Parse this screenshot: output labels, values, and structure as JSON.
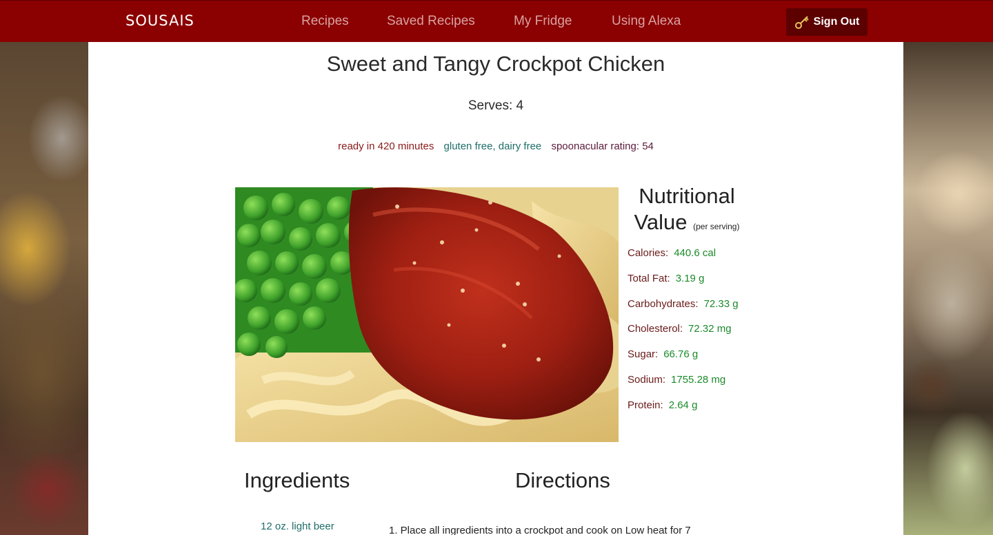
{
  "navbar": {
    "brand": "SOUSAIS",
    "links": [
      {
        "label": "Recipes"
      },
      {
        "label": "Saved Recipes"
      },
      {
        "label": "My Fridge"
      },
      {
        "label": "Using Alexa"
      }
    ],
    "sign_out_label": "Sign Out",
    "sign_out_icon": "key-icon",
    "colors": {
      "bar": "#8b0000",
      "link": "#d9a3a3",
      "button": "#5c0000"
    }
  },
  "recipe": {
    "title": "Sweet and Tangy Crockpot Chicken",
    "serves": "Serves: 4",
    "ready": "ready in 420 minutes",
    "diets": "gluten free, dairy free",
    "rating": "spoonacular rating: 54"
  },
  "nutrition": {
    "heading_line1": "Nutritional",
    "heading_line2": "Value",
    "heading_note": "(per serving)",
    "rows": [
      {
        "label": "Calories:",
        "value": "440.6 cal"
      },
      {
        "label": "Total Fat:",
        "value": "3.19 g"
      },
      {
        "label": "Carbohydrates:",
        "value": "72.33 g"
      },
      {
        "label": "Cholesterol:",
        "value": "72.32 mg"
      },
      {
        "label": "Sugar:",
        "value": "66.76 g"
      },
      {
        "label": "Sodium:",
        "value": "1755.28 mg"
      },
      {
        "label": "Protein:",
        "value": "2.64 g"
      }
    ]
  },
  "ingredients": {
    "heading": "Ingredients",
    "items": [
      "12 oz. light beer"
    ]
  },
  "directions": {
    "heading": "Directions",
    "items": [
      "1. Place all ingredients into a crockpot and cook on Low heat for 7"
    ]
  }
}
